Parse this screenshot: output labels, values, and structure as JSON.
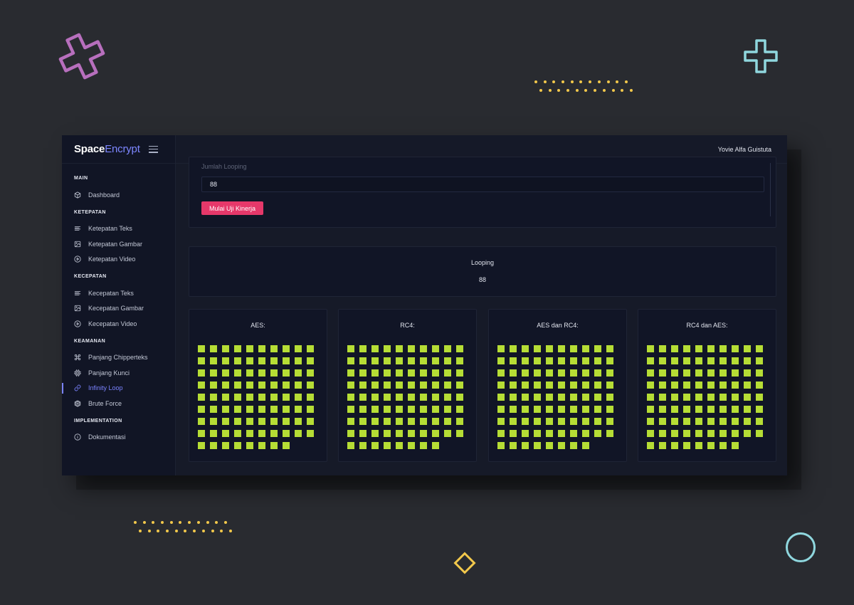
{
  "brand": {
    "strong": "Space",
    "light": "Encrypt"
  },
  "user": {
    "name": "Yovie Alfa Guistuta"
  },
  "sidebar": {
    "sections": [
      {
        "title": "MAIN",
        "items": [
          {
            "label": "Dashboard",
            "icon": "cube-icon"
          }
        ]
      },
      {
        "title": "KETEPATAN",
        "items": [
          {
            "label": "Ketepatan Teks",
            "icon": "align-left-icon"
          },
          {
            "label": "Ketepatan Gambar",
            "icon": "image-icon"
          },
          {
            "label": "Ketepatan Video",
            "icon": "play-circle-icon"
          }
        ]
      },
      {
        "title": "KECEPATAN",
        "items": [
          {
            "label": "Kecepatan Teks",
            "icon": "align-left-icon"
          },
          {
            "label": "Kecepatan Gambar",
            "icon": "image-icon"
          },
          {
            "label": "Kecepatan Video",
            "icon": "play-circle-icon"
          }
        ]
      },
      {
        "title": "KEAMANAN",
        "items": [
          {
            "label": "Panjang Chipperteks",
            "icon": "command-icon"
          },
          {
            "label": "Panjang Kunci",
            "icon": "cpu-icon"
          },
          {
            "label": "Infinity Loop",
            "icon": "link-icon",
            "active": true
          },
          {
            "label": "Brute Force",
            "icon": "codesandbox-icon"
          }
        ]
      },
      {
        "title": "IMPLEMENTATION",
        "items": [
          {
            "label": "Dokumentasi",
            "icon": "info-icon"
          }
        ]
      }
    ]
  },
  "form": {
    "label": "Jumlah Looping",
    "value": "88",
    "button_label": "Mulai Uji Kinerja"
  },
  "stat": {
    "title": "Looping",
    "value": "88"
  },
  "results": [
    {
      "title": "AES:",
      "count": 88
    },
    {
      "title": "RC4:",
      "count": 88
    },
    {
      "title": "AES dan RC4:",
      "count": 88
    },
    {
      "title": "RC4 dan AES:",
      "count": 88
    }
  ],
  "colors": {
    "accent": "#7b83ff",
    "button": "#e6386a",
    "square": "#b6dd35",
    "deco_pink": "#b76fbd",
    "deco_cyan": "#8fd7de",
    "deco_yellow": "#f2c84b"
  }
}
